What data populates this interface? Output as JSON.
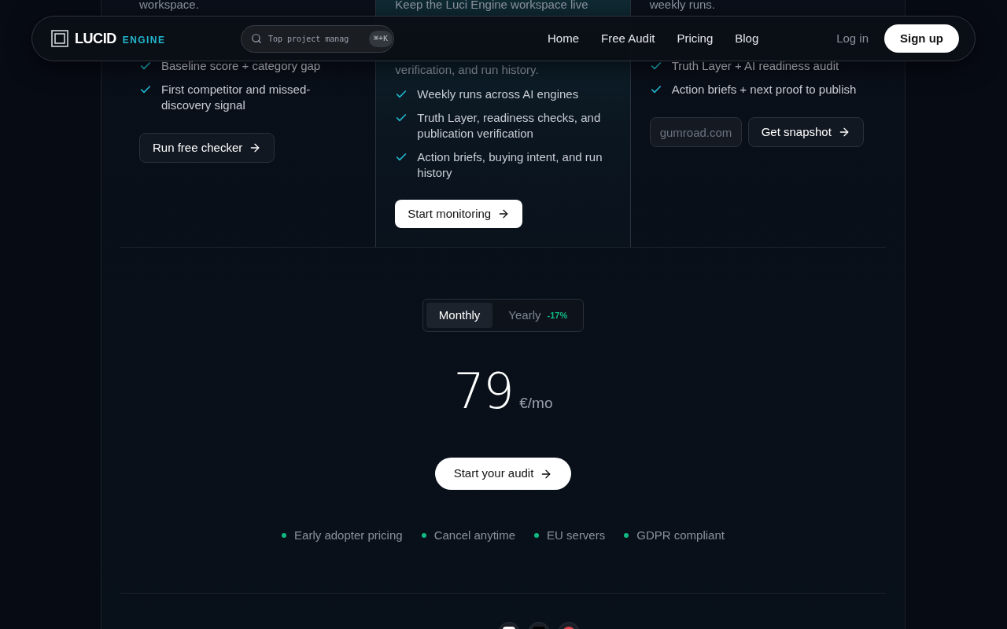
{
  "header": {
    "logo_primary": "LUCID",
    "logo_secondary": "ENGINE",
    "search": {
      "value": "Top project manag",
      "shortcut": "⌘+K"
    },
    "nav": [
      "Home",
      "Free Audit",
      "Pricing",
      "Blog"
    ],
    "login": "Log in",
    "signup": "Sign up"
  },
  "plans": [
    {
      "kind": "free",
      "intro": [
        "workspace."
      ],
      "features": [
        "Baseline score + category gap",
        "First competitor and missed-discovery signal"
      ],
      "button": "Run free checker"
    },
    {
      "kind": "featured",
      "intro": [
        "Keep the Luci Engine workspace live",
        "verification, and run history."
      ],
      "features": [
        "Weekly runs across AI engines",
        "Truth Layer, readiness checks, and publication verification",
        "Action briefs, buying intent, and run history"
      ],
      "button": "Start monitoring"
    },
    {
      "kind": "snapshot",
      "intro": [
        "weekly runs."
      ],
      "features": [
        "Truth Layer + AI readiness audit",
        "Action briefs + next proof to publish"
      ],
      "input_placeholder": "gumroad.com",
      "button": "Get snapshot"
    }
  ],
  "billing": {
    "options": [
      {
        "label": "Monthly",
        "selected": true
      },
      {
        "label": "Yearly",
        "selected": false,
        "badge": "-17%"
      }
    ]
  },
  "price": {
    "amount": "79",
    "unit": "€/mo"
  },
  "cta": "Start your audit",
  "perks": [
    {
      "label": "Early adopter pricing",
      "color": "#10b981"
    },
    {
      "label": "Cancel anytime",
      "color": "#10b981"
    },
    {
      "label": "EU servers",
      "color": "#10b981"
    },
    {
      "label": "GDPR compliant",
      "color": "#10b981"
    }
  ]
}
